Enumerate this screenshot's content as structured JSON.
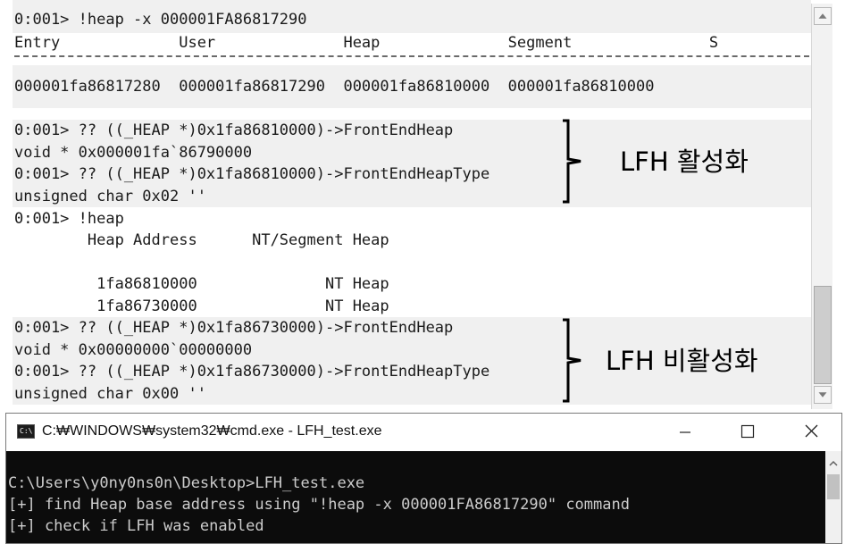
{
  "debugger": {
    "lines": [
      "0:001> !heap -x 000001FA86817290",
      "Entry             User              Heap              Segment               S",
      "000001fa86817280  000001fa86817290  000001fa86810000  000001fa86810000",
      "0:001> ?? ((_HEAP *)0x1fa86810000)->FrontEndHeap",
      "void * 0x000001fa`86790000",
      "0:001> ?? ((_HEAP *)0x1fa86810000)->FrontEndHeapType",
      "unsigned char 0x02 ''",
      "0:001> !heap",
      "        Heap Address      NT/Segment Heap",
      "         1fa86810000              NT Heap",
      "         1fa86730000              NT Heap",
      "0:001> ?? ((_HEAP *)0x1fa86730000)->FrontEndHeap",
      "void * 0x00000000`00000000",
      "0:001> ?? ((_HEAP *)0x1fa86730000)->FrontEndHeapType",
      "unsigned char 0x00 ''"
    ],
    "annotations": {
      "enabled": "LFH 활성화",
      "disabled": "LFH 비활성화"
    }
  },
  "cmd_window": {
    "title": "C:₩WINDOWS₩system32₩cmd.exe - LFH_test.exe",
    "icon_label": "C:\\",
    "output": [
      "C:\\Users\\y0ny0ns0n\\Desktop>LFH_test.exe",
      "[+] find Heap base address using \"!heap -x 000001FA86817290\" command",
      "[+] check if LFH was enabled"
    ]
  },
  "colors": {
    "console_bg": "#0c0c0c",
    "console_text": "#cccccc",
    "highlight_band": "#f0f0f0"
  }
}
